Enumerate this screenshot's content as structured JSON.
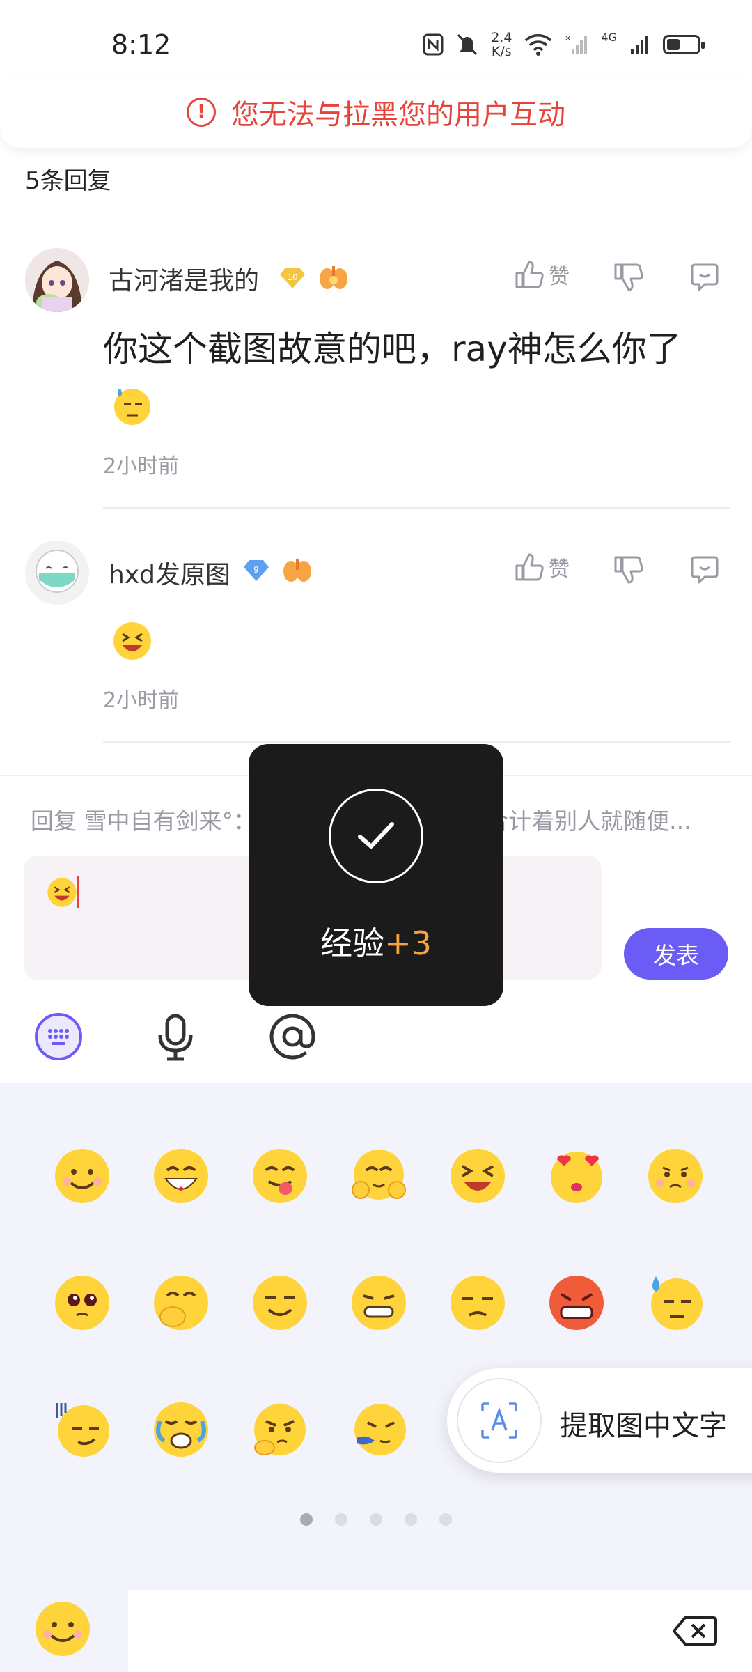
{
  "status_bar": {
    "time": "8:12",
    "speed_value": "2.4",
    "speed_unit": "K/s",
    "network": "4G"
  },
  "banner": {
    "text": "您无法与拉黑您的用户互动"
  },
  "thread": {
    "reply_count": "5条回复"
  },
  "comments": [
    {
      "username": "古河渚是我的",
      "level": "10",
      "text": "你这个截图故意的吧，ray神怎么你了",
      "emoji": "sweat-emoji",
      "time": "2小时前",
      "like_label": "赞"
    },
    {
      "username": "hxd发原图",
      "level": "9",
      "text": "",
      "emoji": "laughing-emoji",
      "time": "2小时前",
      "like_label": "赞"
    }
  ],
  "reply_box": {
    "hint": "回复 雪中自有剑来°：回复 古河渚是我的 :我合计着别人就随便...",
    "send_label": "发表"
  },
  "toast": {
    "label": "经验",
    "bonus": "+3"
  },
  "emoji_panel": {
    "rows": [
      [
        "smile",
        "grin",
        "tongue",
        "blush-hands",
        "laugh",
        "heart-eyes",
        "shy"
      ],
      [
        "pleading",
        "cover-mouth",
        "smug",
        "grimace",
        "unamused",
        "angry",
        "sweat"
      ],
      [
        "gloom",
        "crying",
        "thinking",
        "sneeze"
      ]
    ],
    "pages": 5,
    "active_page": 1
  },
  "extract_text": {
    "label": "提取图中文字"
  },
  "colors": {
    "accent": "#6b5cf5",
    "warning": "#e8433a",
    "toast_bonus": "#f5a33c"
  }
}
